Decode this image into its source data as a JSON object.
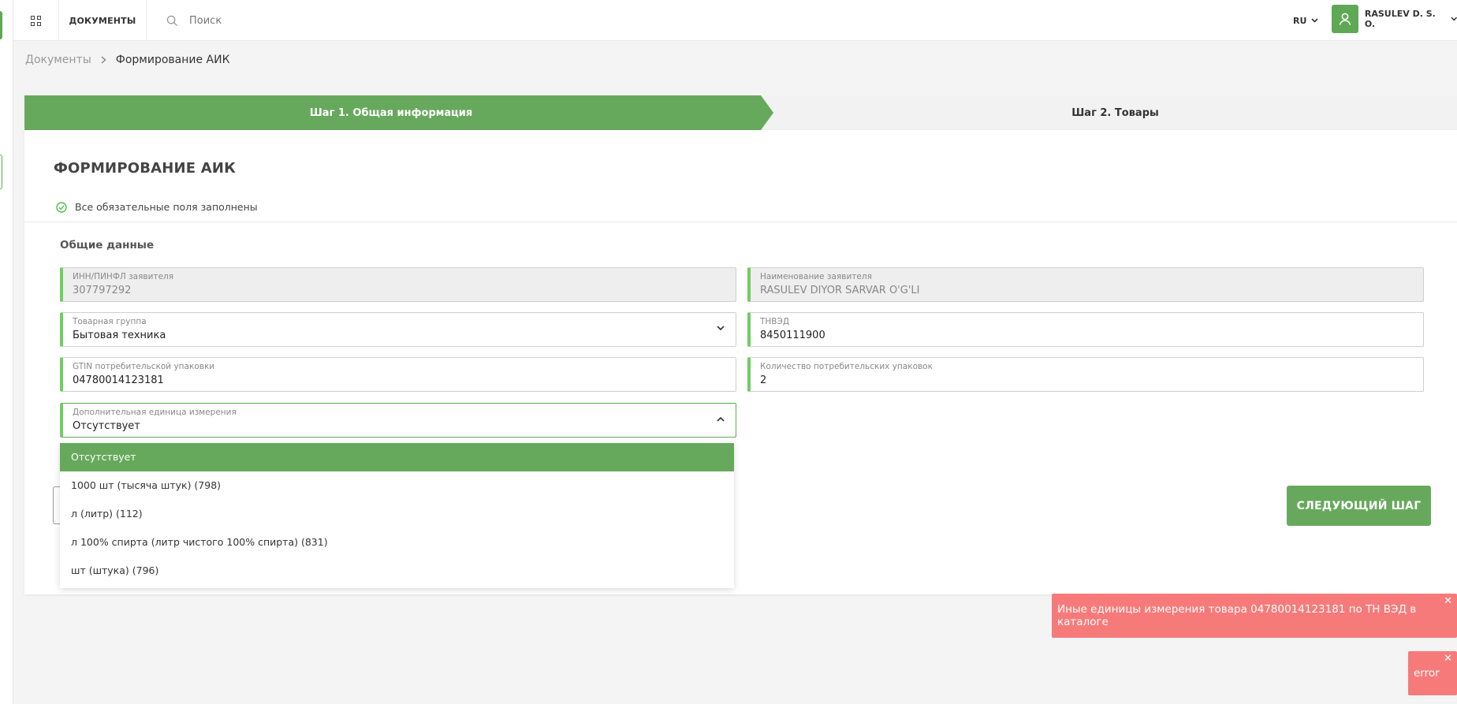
{
  "topbar": {
    "nav_documents": "ДОКУМЕНТЫ",
    "search_placeholder": "Поиск",
    "language": "RU",
    "user_name": "RASULEV D. S. O."
  },
  "breadcrumb": {
    "parent": "Документы",
    "current": "Формирование АИК"
  },
  "steps": [
    {
      "label": "Шаг 1. Общая информация",
      "active": true
    },
    {
      "label": "Шаг 2. Товары",
      "active": false
    }
  ],
  "form": {
    "title": "ФОРМИРОВАНИЕ АИК",
    "status_text": "Все обязательные поля заполнены",
    "section_title": "Общие данные",
    "fields": {
      "inn": {
        "label": "ИНН/ПИНФЛ заявителя",
        "value": "307797292"
      },
      "applicant": {
        "label": "Наименование заявителя",
        "value": "RASULEV DIYOR SARVAR O'G'LI"
      },
      "group": {
        "label": "Товарная группа",
        "value": "Бытовая техника"
      },
      "tnved": {
        "label": "ТНВЭД",
        "value": "8450111900"
      },
      "gtin": {
        "label": "GTIN потребительской упаковки",
        "value": "04780014123181"
      },
      "quantity": {
        "label": "Количество потребительских упаковок",
        "value": "2"
      },
      "unit": {
        "label": "Дополнительная единица измерения",
        "value": "Отсутствует"
      }
    },
    "unit_options": [
      "Отсутствует",
      "1000 шт (тысяча штук) (798)",
      "л (литр) (112)",
      "л 100% спирта (литр чистого 100% спирта) (831)",
      "шт (штука) (796)"
    ],
    "next_button": "СЛЕДУЮЩИЙ ШАГ"
  },
  "toasts": [
    {
      "text": "Иные единицы измерения товара 04780014123181 по ТН ВЭД в каталоге"
    },
    {
      "text": "error"
    }
  ],
  "colors": {
    "accent": "#67a95c",
    "field_border_accent": "#6ecf5f",
    "error_toast": "#f77a7a"
  }
}
